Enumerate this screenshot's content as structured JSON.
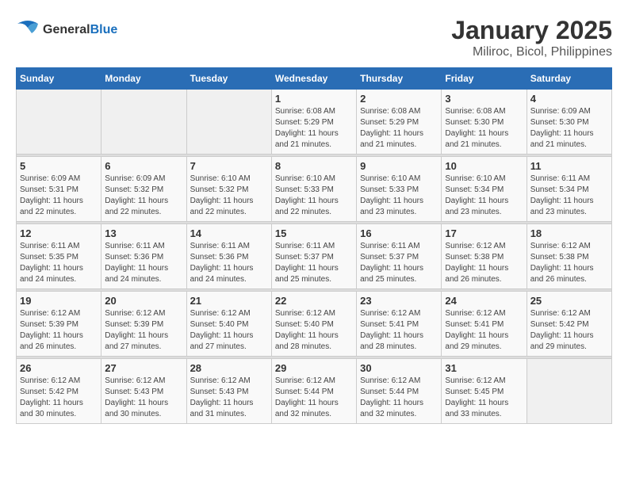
{
  "logo": {
    "general": "General",
    "blue": "Blue"
  },
  "title": "January 2025",
  "subtitle": "Miliroc, Bicol, Philippines",
  "days_of_week": [
    "Sunday",
    "Monday",
    "Tuesday",
    "Wednesday",
    "Thursday",
    "Friday",
    "Saturday"
  ],
  "weeks": [
    [
      {
        "day": "",
        "empty": true
      },
      {
        "day": "",
        "empty": true
      },
      {
        "day": "",
        "empty": true
      },
      {
        "day": "1",
        "sunrise": "6:08 AM",
        "sunset": "5:29 PM",
        "daylight": "11 hours and 21 minutes."
      },
      {
        "day": "2",
        "sunrise": "6:08 AM",
        "sunset": "5:29 PM",
        "daylight": "11 hours and 21 minutes."
      },
      {
        "day": "3",
        "sunrise": "6:08 AM",
        "sunset": "5:30 PM",
        "daylight": "11 hours and 21 minutes."
      },
      {
        "day": "4",
        "sunrise": "6:09 AM",
        "sunset": "5:30 PM",
        "daylight": "11 hours and 21 minutes."
      }
    ],
    [
      {
        "day": "5",
        "sunrise": "6:09 AM",
        "sunset": "5:31 PM",
        "daylight": "11 hours and 22 minutes."
      },
      {
        "day": "6",
        "sunrise": "6:09 AM",
        "sunset": "5:32 PM",
        "daylight": "11 hours and 22 minutes."
      },
      {
        "day": "7",
        "sunrise": "6:10 AM",
        "sunset": "5:32 PM",
        "daylight": "11 hours and 22 minutes."
      },
      {
        "day": "8",
        "sunrise": "6:10 AM",
        "sunset": "5:33 PM",
        "daylight": "11 hours and 22 minutes."
      },
      {
        "day": "9",
        "sunrise": "6:10 AM",
        "sunset": "5:33 PM",
        "daylight": "11 hours and 23 minutes."
      },
      {
        "day": "10",
        "sunrise": "6:10 AM",
        "sunset": "5:34 PM",
        "daylight": "11 hours and 23 minutes."
      },
      {
        "day": "11",
        "sunrise": "6:11 AM",
        "sunset": "5:34 PM",
        "daylight": "11 hours and 23 minutes."
      }
    ],
    [
      {
        "day": "12",
        "sunrise": "6:11 AM",
        "sunset": "5:35 PM",
        "daylight": "11 hours and 24 minutes."
      },
      {
        "day": "13",
        "sunrise": "6:11 AM",
        "sunset": "5:36 PM",
        "daylight": "11 hours and 24 minutes."
      },
      {
        "day": "14",
        "sunrise": "6:11 AM",
        "sunset": "5:36 PM",
        "daylight": "11 hours and 24 minutes."
      },
      {
        "day": "15",
        "sunrise": "6:11 AM",
        "sunset": "5:37 PM",
        "daylight": "11 hours and 25 minutes."
      },
      {
        "day": "16",
        "sunrise": "6:11 AM",
        "sunset": "5:37 PM",
        "daylight": "11 hours and 25 minutes."
      },
      {
        "day": "17",
        "sunrise": "6:12 AM",
        "sunset": "5:38 PM",
        "daylight": "11 hours and 26 minutes."
      },
      {
        "day": "18",
        "sunrise": "6:12 AM",
        "sunset": "5:38 PM",
        "daylight": "11 hours and 26 minutes."
      }
    ],
    [
      {
        "day": "19",
        "sunrise": "6:12 AM",
        "sunset": "5:39 PM",
        "daylight": "11 hours and 26 minutes."
      },
      {
        "day": "20",
        "sunrise": "6:12 AM",
        "sunset": "5:39 PM",
        "daylight": "11 hours and 27 minutes."
      },
      {
        "day": "21",
        "sunrise": "6:12 AM",
        "sunset": "5:40 PM",
        "daylight": "11 hours and 27 minutes."
      },
      {
        "day": "22",
        "sunrise": "6:12 AM",
        "sunset": "5:40 PM",
        "daylight": "11 hours and 28 minutes."
      },
      {
        "day": "23",
        "sunrise": "6:12 AM",
        "sunset": "5:41 PM",
        "daylight": "11 hours and 28 minutes."
      },
      {
        "day": "24",
        "sunrise": "6:12 AM",
        "sunset": "5:41 PM",
        "daylight": "11 hours and 29 minutes."
      },
      {
        "day": "25",
        "sunrise": "6:12 AM",
        "sunset": "5:42 PM",
        "daylight": "11 hours and 29 minutes."
      }
    ],
    [
      {
        "day": "26",
        "sunrise": "6:12 AM",
        "sunset": "5:42 PM",
        "daylight": "11 hours and 30 minutes."
      },
      {
        "day": "27",
        "sunrise": "6:12 AM",
        "sunset": "5:43 PM",
        "daylight": "11 hours and 30 minutes."
      },
      {
        "day": "28",
        "sunrise": "6:12 AM",
        "sunset": "5:43 PM",
        "daylight": "11 hours and 31 minutes."
      },
      {
        "day": "29",
        "sunrise": "6:12 AM",
        "sunset": "5:44 PM",
        "daylight": "11 hours and 32 minutes."
      },
      {
        "day": "30",
        "sunrise": "6:12 AM",
        "sunset": "5:44 PM",
        "daylight": "11 hours and 32 minutes."
      },
      {
        "day": "31",
        "sunrise": "6:12 AM",
        "sunset": "5:45 PM",
        "daylight": "11 hours and 33 minutes."
      },
      {
        "day": "",
        "empty": true
      }
    ]
  ],
  "labels": {
    "sunrise": "Sunrise:",
    "sunset": "Sunset:",
    "daylight": "Daylight:"
  }
}
